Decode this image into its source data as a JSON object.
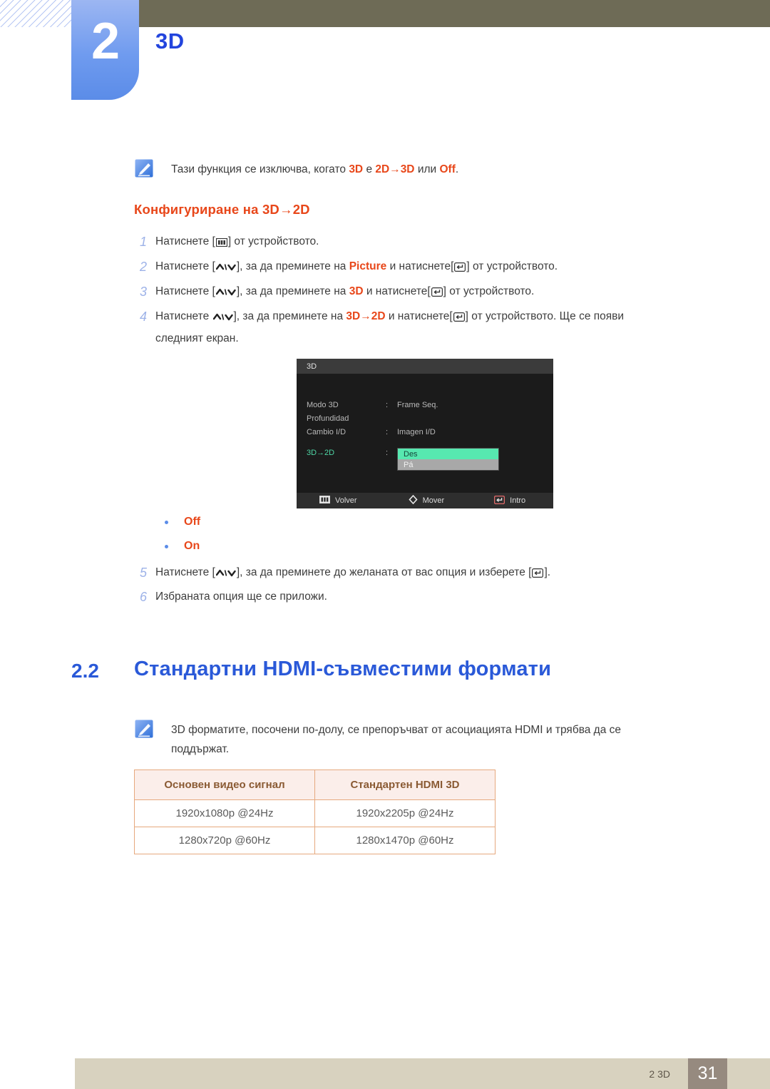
{
  "chapter": {
    "number": "2",
    "title": "3D"
  },
  "note_top": {
    "icon": "note-pen-icon",
    "text_parts": [
      {
        "t": "Тази функция се изключва, когато ",
        "style": "plain"
      },
      {
        "t": "3D",
        "style": "red"
      },
      {
        "t": " е ",
        "style": "plain"
      },
      {
        "t": "2D→3D",
        "style": "red"
      },
      {
        "t": " или ",
        "style": "plain"
      },
      {
        "t": "Off",
        "style": "red"
      },
      {
        "t": ".",
        "style": "plain"
      }
    ],
    "text_plain": "Тази функция се изключва, когато 3D е 2D→3D или Off."
  },
  "sub_heading": "Конфигуриране на 3D→2D",
  "steps": [
    {
      "num": "1",
      "plain": "Натиснете [▥] от устройството."
    },
    {
      "num": "2",
      "plain": "Натиснете [∧/∨], за да преминете на Picture и натиснете[↵] от устройството."
    },
    {
      "num": "3",
      "plain": "Натиснете [∧/∨], за да преминете на 3D и натиснете[↵] от устройството."
    },
    {
      "num": "4",
      "plain": "Натиснете ∧/∨], за да преминете на 3D→2D и натиснете[↵] от устройството. Ще се появи следният екран."
    },
    {
      "num": "5",
      "plain": "Натиснете [∧/∨], за да преминете до желаната от вас опция и изберете [↵]."
    },
    {
      "num": "6",
      "plain": "Избраната опция ще се приложи."
    }
  ],
  "step_fragments": {
    "s1_a": "Натиснете [",
    "s1_b": "] от устройството.",
    "s2_a": "Натиснете [",
    "s2_b": "], за да преминете на ",
    "s2_kw": "Picture",
    "s2_c": " и натиснете[",
    "s2_d": "] от устройството.",
    "s3_a": "Натиснете [",
    "s3_b": "], за да преминете на ",
    "s3_kw": "3D",
    "s3_c": " и натиснете[",
    "s3_d": "] от устройството.",
    "s4_a": "Натиснете ",
    "s4_b": "], за да преминете на ",
    "s4_kw": "3D→2D",
    "s4_c": " и натиснете[",
    "s4_d": "] от устройството. Ще се появи",
    "s4_line2": "следният екран.",
    "s5_a": "Натиснете [",
    "s5_b": "], за да преминете до желаната от вас опция и изберете [",
    "s5_c": "].",
    "s6_a": "Избраната опция ще се приложи."
  },
  "bullets": [
    {
      "label": "Off"
    },
    {
      "label": "On"
    }
  ],
  "osd": {
    "title": "3D",
    "rows": [
      {
        "label": "Modo 3D",
        "colon": ":",
        "value": "Frame Seq.",
        "active": false
      },
      {
        "label": "Profundidad",
        "colon": "",
        "value": "",
        "active": false
      },
      {
        "label": "Cambio I/D",
        "colon": ":",
        "value": "Imagen I/D",
        "active": false
      },
      {
        "label": "3D→2D",
        "colon": ":",
        "value": "",
        "active": true
      }
    ],
    "dropdown": {
      "selected": "Des",
      "unselected": "Pá"
    },
    "footer": [
      {
        "icon": "menu-bars-icon",
        "label": "Volver"
      },
      {
        "icon": "diamond-move-icon",
        "label": "Mover"
      },
      {
        "icon": "enter-return-icon",
        "label": "Intro"
      }
    ],
    "colors": {
      "background": "#1b1b1b",
      "title_bar": "#3b3b3b",
      "selected_highlight": "#57e8b0",
      "unselected": "#a8a8a8",
      "active_label": "#4fd6a5"
    }
  },
  "section": {
    "number": "2.2",
    "title": "Стандартни HDMI-съвместими формати"
  },
  "note_bottom": {
    "icon": "note-pen-icon",
    "line1": "3D форматите, посочени по-долу, се препоръчват от асоциацията HDMI и трябва да се",
    "line2": "поддържат."
  },
  "table": {
    "headers": [
      "Основен видео сигнал",
      "Стандартен HDMI 3D"
    ],
    "rows": [
      [
        "1920x1080p @24Hz",
        "1920x2205p @24Hz"
      ],
      [
        "1280x720p @60Hz",
        "1280x1470p @60Hz"
      ]
    ]
  },
  "footer": {
    "label": "2 3D",
    "page": "31"
  },
  "theme": {
    "accent_blue": "#2a59d8",
    "accent_red": "#e8471a",
    "olive": "#6e6b56",
    "footer_bar": "#d8d2bf",
    "page_box": "#968a7f",
    "table_border": "#e6a97e",
    "table_header_bg": "#fbeeea",
    "table_header_text": "#8a5a33"
  }
}
